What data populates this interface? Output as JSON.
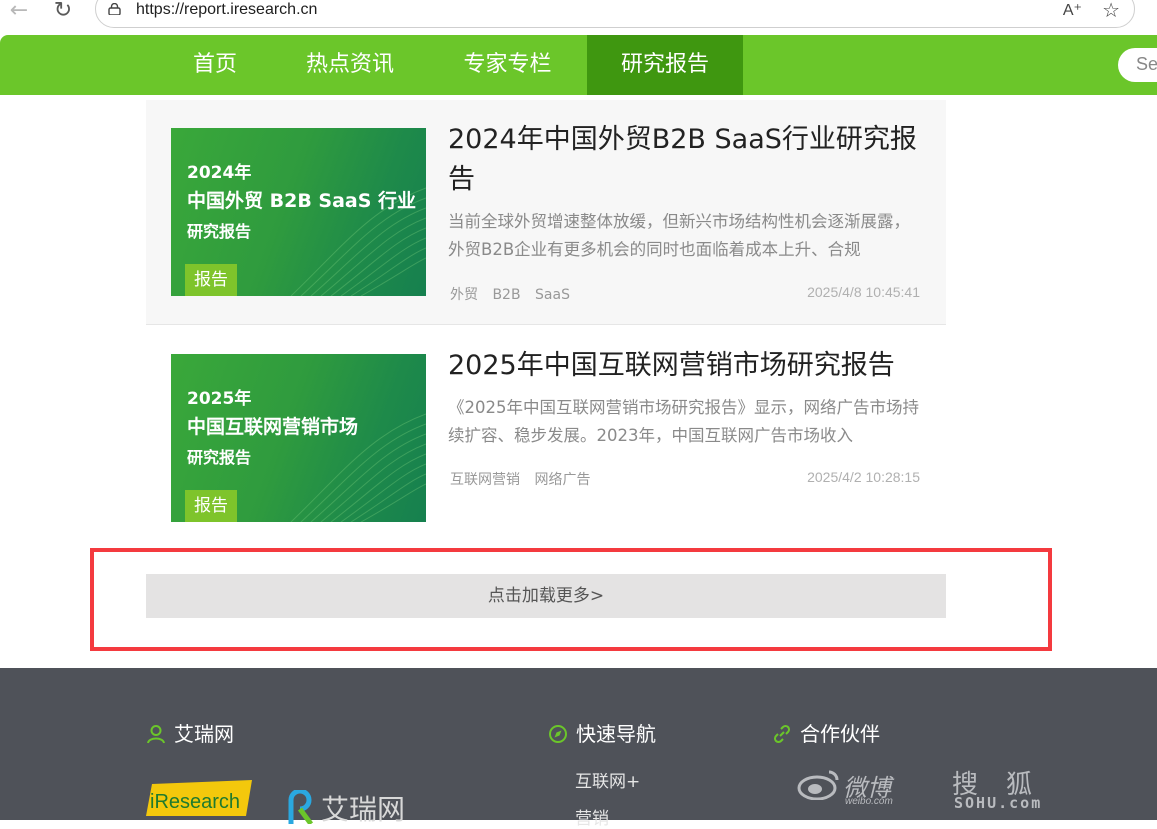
{
  "browser": {
    "url": "https://report.iresearch.cn",
    "read_aloud_label": "Ȃ"
  },
  "nav": {
    "items": [
      "首页",
      "热点资讯",
      "专家专栏",
      "研究报告"
    ],
    "active_index": 3,
    "search_placeholder": "Se",
    "colors": {
      "bar": "#6bc62a",
      "active": "#3f9710"
    }
  },
  "articles": [
    {
      "thumb_year": "2024年",
      "thumb_title": "中国外贸 B2B SaaS 行业",
      "thumb_sub": "研究报告",
      "thumb_tag": "报告",
      "title": "2024年中国外贸B2B SaaS行业研究报告",
      "desc": "当前全球外贸增速整体放缓，但新兴市场结构性机会逐渐展露，外贸B2B企业有更多机会的同时也面临着成本上升、合规",
      "tags": [
        "外贸",
        "B2B",
        "SaaS"
      ],
      "date": "2025/4/8 10:45:41"
    },
    {
      "thumb_year": "2025年",
      "thumb_title": "中国互联网营销市场",
      "thumb_sub": "研究报告",
      "thumb_tag": "报告",
      "title": "2025年中国互联网营销市场研究报告",
      "desc": "《2025年中国互联网营销市场研究报告》显示，网络广告市场持续扩容、稳步发展。2023年，中国互联网广告市场收入",
      "tags": [
        "互联网营销",
        "网络广告"
      ],
      "date": "2025/4/2 10:28:15"
    }
  ],
  "load_more": "点击加载更多>",
  "footer": {
    "col1_title": "艾瑞网",
    "col2_title": "快速导航",
    "col3_title": "合作伙伴",
    "nav_links": [
      "互联网+",
      "营销"
    ],
    "logo_iresearch": "iResearch",
    "logo_airui": "艾瑞网",
    "partner_weibo": "微博",
    "partner_weibo_sub": "weibo.com",
    "partner_sohu": "搜狐",
    "partner_sohu_sub": "SOHU.com"
  }
}
